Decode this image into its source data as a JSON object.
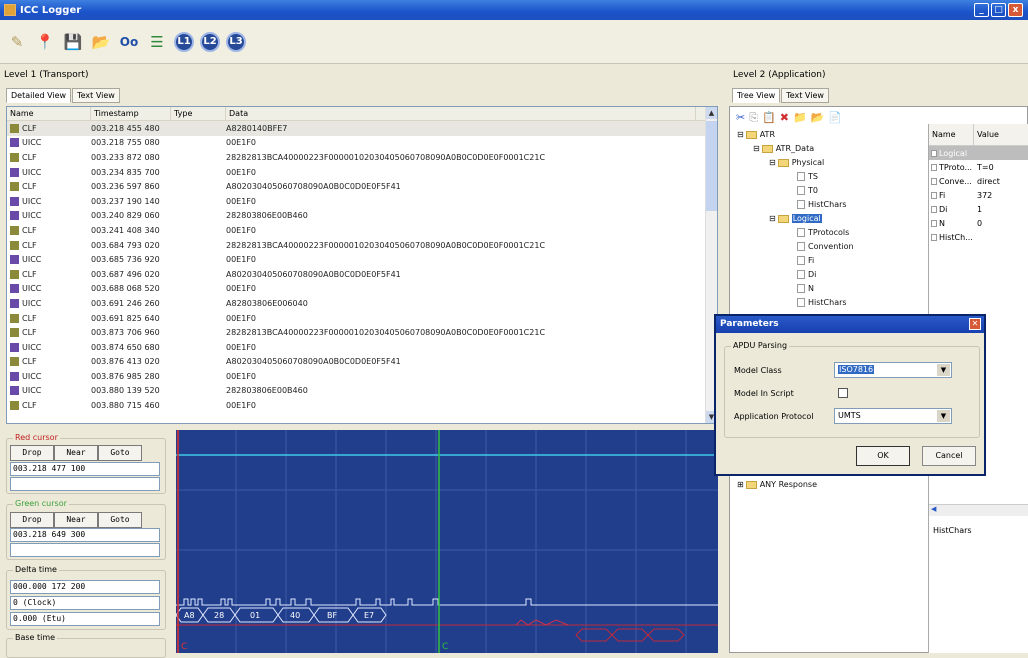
{
  "window": {
    "title": "ICC Logger"
  },
  "toolbar": {
    "l1": "L1",
    "l2": "L2",
    "l3": "L3"
  },
  "level1": {
    "title": "Level 1 (Transport)",
    "tabs": [
      "Detailed View",
      "Text View"
    ]
  },
  "level2": {
    "title": "Level 2 (Application)",
    "tabs": [
      "Tree View",
      "Text View"
    ]
  },
  "table": {
    "headers": [
      "Name",
      "Timestamp",
      "Type",
      "Data"
    ],
    "rows": [
      {
        "name": "CLF",
        "ts": "003.218 455 480",
        "type": "",
        "data": "A8280140BFE7"
      },
      {
        "name": "UICC",
        "ts": "003.218 755 080",
        "type": "",
        "data": "00E1F0"
      },
      {
        "name": "CLF",
        "ts": "003.233 872 080",
        "type": "",
        "data": "28282813BCA40000223F00000102030405060708090A0B0C0D0E0F0001C21C"
      },
      {
        "name": "UICC",
        "ts": "003.234 835 700",
        "type": "",
        "data": "00E1F0"
      },
      {
        "name": "CLF",
        "ts": "003.236 597 860",
        "type": "",
        "data": "A802030405060708090A0B0C0D0E0F5F41"
      },
      {
        "name": "UICC",
        "ts": "003.237 190 140",
        "type": "",
        "data": "00E1F0"
      },
      {
        "name": "UICC",
        "ts": "003.240 829 060",
        "type": "",
        "data": "282803806E00B460"
      },
      {
        "name": "CLF",
        "ts": "003.241 408 340",
        "type": "",
        "data": "00E1F0"
      },
      {
        "name": "CLF",
        "ts": "003.684 793 020",
        "type": "",
        "data": "28282813BCA40000223F00000102030405060708090A0B0C0D0E0F0001C21C"
      },
      {
        "name": "UICC",
        "ts": "003.685 736 920",
        "type": "",
        "data": "00E1F0"
      },
      {
        "name": "CLF",
        "ts": "003.687 496 020",
        "type": "",
        "data": "A802030405060708090A0B0C0D0E0F5F41"
      },
      {
        "name": "UICC",
        "ts": "003.688 068 520",
        "type": "",
        "data": "00E1F0"
      },
      {
        "name": "UICC",
        "ts": "003.691 246 260",
        "type": "",
        "data": "A82803806E006040"
      },
      {
        "name": "CLF",
        "ts": "003.691 825 640",
        "type": "",
        "data": "00E1F0"
      },
      {
        "name": "CLF",
        "ts": "003.873 706 960",
        "type": "",
        "data": "28282813BCA40000223F00000102030405060708090A0B0C0D0E0F0001C21C"
      },
      {
        "name": "UICC",
        "ts": "003.874 650 680",
        "type": "",
        "data": "00E1F0"
      },
      {
        "name": "CLF",
        "ts": "003.876 413 020",
        "type": "",
        "data": "A802030405060708090A0B0C0D0E0F5F41"
      },
      {
        "name": "UICC",
        "ts": "003.876 985 280",
        "type": "",
        "data": "00E1F0"
      },
      {
        "name": "UICC",
        "ts": "003.880 139 520",
        "type": "",
        "data": "282803806E00B460"
      },
      {
        "name": "CLF",
        "ts": "003.880 715 460",
        "type": "",
        "data": "00E1F0"
      }
    ]
  },
  "cursors": {
    "red": {
      "label": "Red cursor",
      "value": "003.218 477 100"
    },
    "green": {
      "label": "Green cursor",
      "value": "003.218 649 300"
    },
    "buttons": {
      "drop": "Drop",
      "near": "Near",
      "goto": "Goto"
    },
    "delta": {
      "label": "Delta time",
      "v1": "000.000 172 200",
      "v2": "0 (Clock)",
      "v3": "0.000 (Etu)"
    },
    "base": {
      "label": "Base time"
    }
  },
  "wave": {
    "bytes": [
      "A8",
      "28",
      "01",
      "40",
      "BF",
      "E7"
    ],
    "marker_red": "C",
    "marker_green": "C"
  },
  "tree": {
    "root": "ATR",
    "atr_data": "ATR_Data",
    "physical": "Physical",
    "ts": "TS",
    "t0": "T0",
    "histchars": "HistChars",
    "logical": "Logical",
    "tprotocols": "TProtocols",
    "convention": "Convention",
    "fi": "Fi",
    "di": "Di",
    "n": "N",
    "histchars2": "HistChars",
    "any": "ANY Response"
  },
  "props": {
    "headers": [
      "Name",
      "Value"
    ],
    "rows": [
      {
        "n": "Logical",
        "v": ""
      },
      {
        "n": "TProto...",
        "v": "T=0"
      },
      {
        "n": "Conve...",
        "v": "direct"
      },
      {
        "n": "Fi",
        "v": "372"
      },
      {
        "n": "Di",
        "v": "1"
      },
      {
        "n": "N",
        "v": "0"
      },
      {
        "n": "HistCh...",
        "v": ""
      }
    ],
    "footer": "HistChars"
  },
  "dialog": {
    "title": "Parameters",
    "group": "APDU Parsing",
    "model_class_label": "Model Class",
    "model_class_value": "ISO7816",
    "model_script_label": "Model In Script",
    "protocol_label": "Application Protocol",
    "protocol_value": "UMTS",
    "ok": "OK",
    "cancel": "Cancel"
  }
}
